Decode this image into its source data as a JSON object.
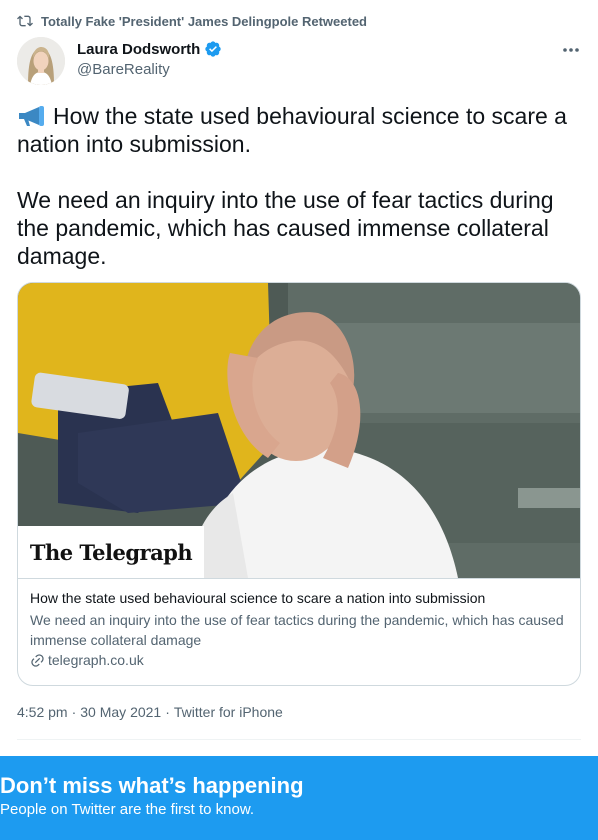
{
  "retweet": {
    "icon": "retweet-icon",
    "text": "Totally Fake 'President' James Delingpole Retweeted"
  },
  "author": {
    "display_name": "Laura Dodsworth",
    "handle": "@BareReality",
    "verified_icon": "verified-badge-icon",
    "verified_color": "#1d9bf0"
  },
  "tweet": {
    "paragraph_1": "How the state used behavioural science to scare a nation into submission.",
    "paragraph_2": "We need an inquiry into the use of fear tactics during the pandemic, which has caused immense collateral damage.",
    "leading_emoji": "megaphone-icon"
  },
  "card": {
    "masthead": "The Telegraph",
    "title": "How the state used behavioural science to scare a nation into submission",
    "description": "We need an inquiry into the use of fear tactics during the pandemic, which has caused immense collateral damage",
    "domain": "telegraph.co.uk",
    "domain_icon": "link-icon"
  },
  "meta": {
    "time": "4:52 pm",
    "date": "30 May 2021",
    "separator": "·",
    "source": "Twitter for iPhone"
  },
  "banner": {
    "title": "Don’t miss what’s happening",
    "subtitle": "People on Twitter are the first to know.",
    "background": "#1d9bf0"
  },
  "colors": {
    "text_primary": "#0f1419",
    "text_secondary": "#536471",
    "border": "#cfd9de"
  }
}
